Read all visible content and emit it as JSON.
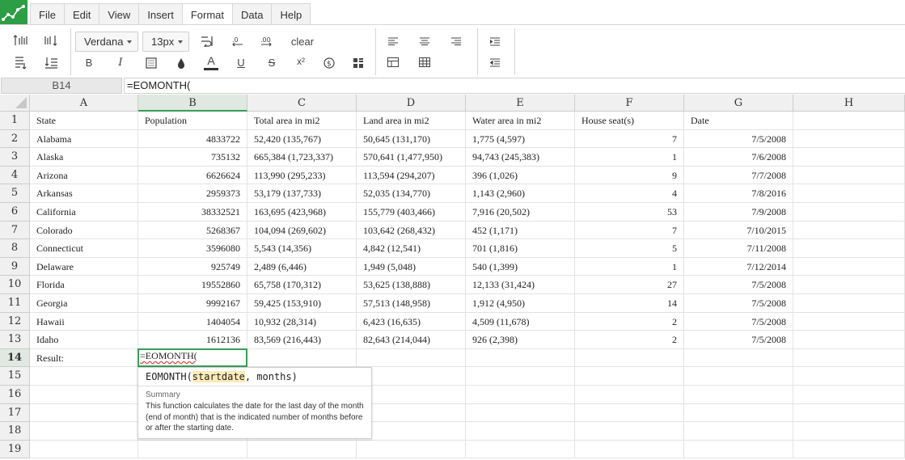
{
  "menu": {
    "items": [
      "File",
      "Edit",
      "View",
      "Insert",
      "Format",
      "Data",
      "Help"
    ],
    "active": "Format"
  },
  "toolbar": {
    "font_family": "Verdana",
    "font_size": "13px",
    "clear_label": "clear",
    "bold_label": "B",
    "italic_label": "I",
    "text_color_label": "A",
    "underline_label": "U",
    "strike_label": "S",
    "superscript_label": "x²",
    "accent_color": "#2e9e46"
  },
  "formula_bar": {
    "cell_ref": "B14",
    "formula": "=EOMONTH("
  },
  "columns": [
    "A",
    "B",
    "C",
    "D",
    "E",
    "F",
    "G",
    "H"
  ],
  "selected_column": "B",
  "rows": [
    "1",
    "2",
    "3",
    "4",
    "5",
    "6",
    "7",
    "8",
    "9",
    "10",
    "11",
    "12",
    "13",
    "14",
    "15",
    "16",
    "17",
    "18",
    "19"
  ],
  "selected_row": "14",
  "header_row": [
    "State",
    "Population",
    "Total area in mi2",
    "Land area in mi2",
    "Water area in mi2",
    "House seat(s)",
    "Date"
  ],
  "data_rows": [
    [
      "Alabama",
      "4833722",
      "52,420 (135,767)",
      "50,645 (131,170)",
      "1,775 (4,597)",
      "7",
      "7/5/2008"
    ],
    [
      "Alaska",
      "735132",
      "665,384 (1,723,337)",
      "570,641 (1,477,950)",
      "94,743 (245,383)",
      "1",
      "7/6/2008"
    ],
    [
      "Arizona",
      "6626624",
      "113,990 (295,233)",
      "113,594 (294,207)",
      "396 (1,026)",
      "9",
      "7/7/2008"
    ],
    [
      "Arkansas",
      "2959373",
      "53,179 (137,733)",
      "52,035 (134,770)",
      "1,143 (2,960)",
      "4",
      "7/8/2016"
    ],
    [
      "California",
      "38332521",
      "163,695 (423,968)",
      "155,779 (403,466)",
      "7,916 (20,502)",
      "53",
      "7/9/2008"
    ],
    [
      "Colorado",
      "5268367",
      "104,094 (269,602)",
      "103,642 (268,432)",
      "452 (1,171)",
      "7",
      "7/10/2015"
    ],
    [
      "Connecticut",
      "3596080",
      "5,543 (14,356)",
      "4,842 (12,541)",
      "701 (1,816)",
      "5",
      "7/11/2008"
    ],
    [
      "Delaware",
      "925749",
      "2,489 (6,446)",
      "1,949 (5,048)",
      "540 (1,399)",
      "1",
      "7/12/2014"
    ],
    [
      "Florida",
      "19552860",
      "65,758 (170,312)",
      "53,625 (138,888)",
      "12,133 (31,424)",
      "27",
      "7/5/2008"
    ],
    [
      "Georgia",
      "9992167",
      "59,425 (153,910)",
      "57,513 (148,958)",
      "1,912 (4,950)",
      "14",
      "7/5/2008"
    ],
    [
      "Hawaii",
      "1404054",
      "10,932 (28,314)",
      "6,423 (16,635)",
      "4,509 (11,678)",
      "2",
      "7/5/2008"
    ],
    [
      "Idaho",
      "1612136",
      "83,569 (216,443)",
      "82,643 (214,044)",
      "926 (2,398)",
      "2",
      "7/5/2008"
    ]
  ],
  "result_label": "Result:",
  "active_cell_value": "=EOMONTH(",
  "tooltip": {
    "fn_name": "EOMONTH(",
    "arg1": "startdate",
    "sep": ", ",
    "arg2": "months",
    "close": ")",
    "summary_label": "Summary",
    "description": "This function calculates the date for the last day of the month (end of month) that is the indicated number of months before or after the starting date."
  }
}
